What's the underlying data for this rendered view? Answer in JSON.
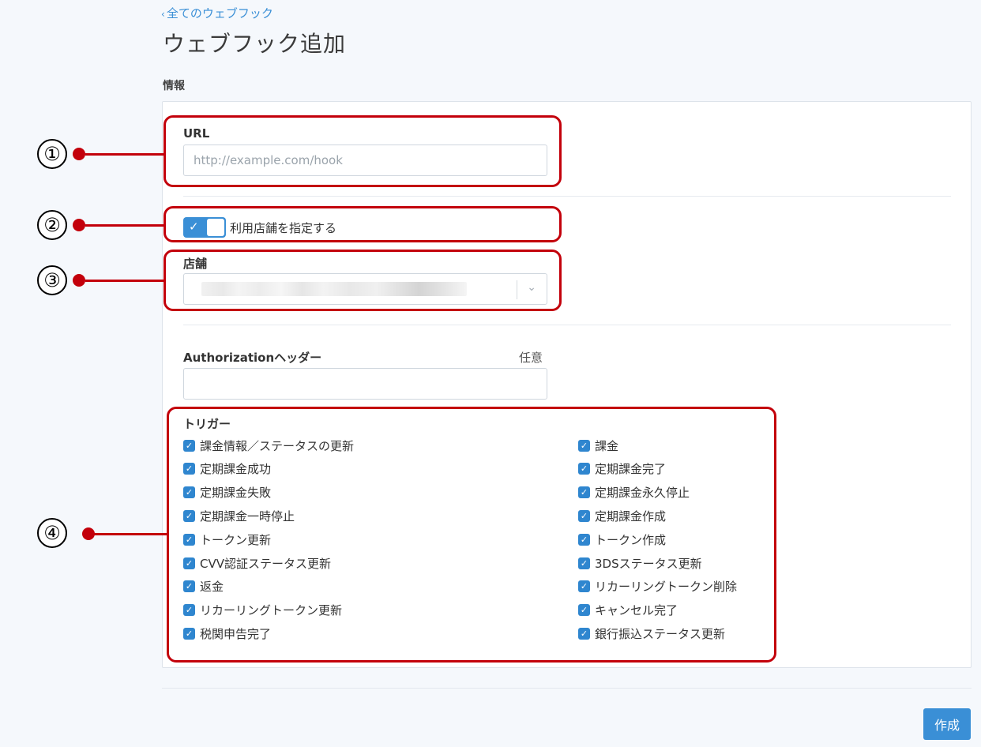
{
  "header": {
    "back_link": "全てのウェブフック",
    "back_chevron": "‹",
    "title": "ウェブフック追加"
  },
  "section_label": "情報",
  "form": {
    "url": {
      "label": "URL",
      "placeholder": "http://example.com/hook",
      "value": ""
    },
    "store_toggle": {
      "label": "利用店舗を指定する",
      "checked": true
    },
    "store": {
      "label": "店舗"
    },
    "authorization": {
      "label": "Authorizationヘッダー",
      "optional": "任意",
      "value": ""
    },
    "triggers": {
      "heading": "トリガー",
      "left": [
        {
          "label": "課金情報／ステータスの更新",
          "checked": true
        },
        {
          "label": "定期課金成功",
          "checked": true
        },
        {
          "label": "定期課金失敗",
          "checked": true
        },
        {
          "label": "定期課金一時停止",
          "checked": true
        },
        {
          "label": "トークン更新",
          "checked": true
        },
        {
          "label": "CVV認証ステータス更新",
          "checked": true
        },
        {
          "label": "返金",
          "checked": true
        },
        {
          "label": "リカーリングトークン更新",
          "checked": true
        },
        {
          "label": "税関申告完了",
          "checked": true
        }
      ],
      "right": [
        {
          "label": "課金",
          "checked": true
        },
        {
          "label": "定期課金完了",
          "checked": true
        },
        {
          "label": "定期課金永久停止",
          "checked": true
        },
        {
          "label": "定期課金作成",
          "checked": true
        },
        {
          "label": "トークン作成",
          "checked": true
        },
        {
          "label": "3DSステータス更新",
          "checked": true
        },
        {
          "label": "リカーリングトークン削除",
          "checked": true
        },
        {
          "label": "キャンセル完了",
          "checked": true
        },
        {
          "label": "銀行振込ステータス更新",
          "checked": true
        }
      ]
    }
  },
  "submit_label": "作成",
  "annotations": [
    "①",
    "②",
    "③",
    "④"
  ],
  "colors": {
    "accent": "#3a8fd6",
    "annotation": "#c3000b"
  }
}
